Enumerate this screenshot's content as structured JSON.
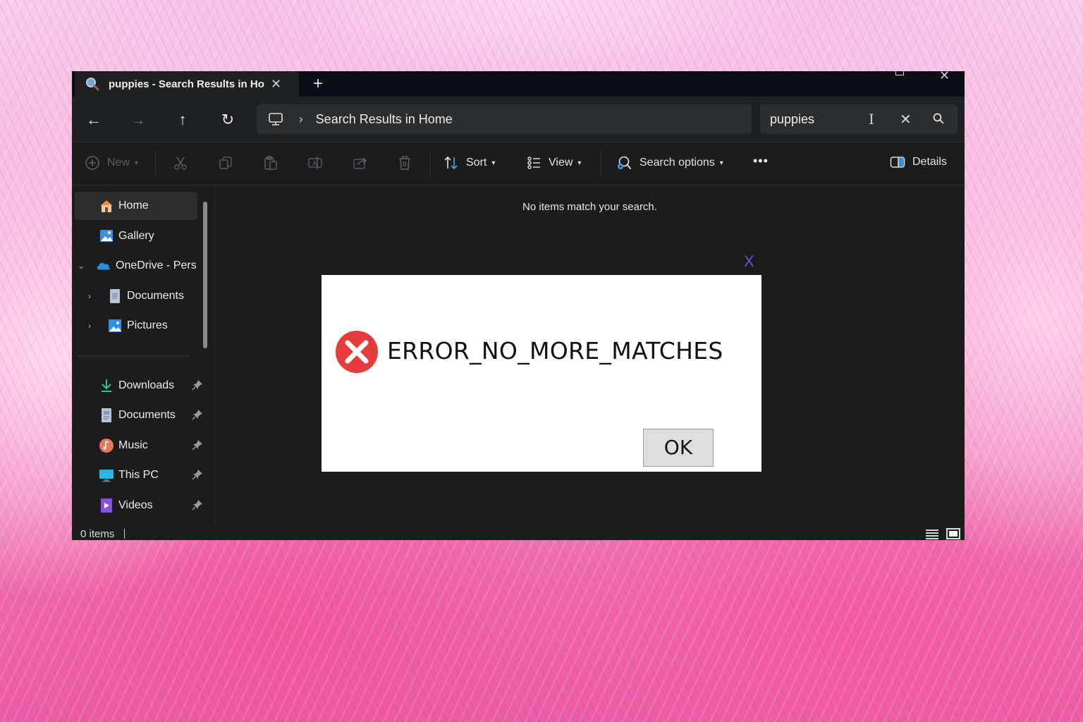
{
  "window": {
    "tab_title": "puppies - Search Results in Ho",
    "tab_icon": "search-icon",
    "new_tab_label": "+",
    "controls": {
      "minimize": "minimize-icon",
      "maximize": "maximize-icon",
      "close": "✕"
    }
  },
  "nav": {
    "back": "←",
    "forward": "→",
    "up": "↑",
    "refresh": "↻",
    "breadcrumb_separator": "›",
    "location": "Search Results in Home"
  },
  "search": {
    "value": "puppies",
    "placeholder": "",
    "clear": "✕"
  },
  "commandbar": {
    "new_label": "New",
    "sort_label": "Sort",
    "view_label": "View",
    "search_options_label": "Search options",
    "more_label": "•••",
    "details_label": "Details",
    "disabled_actions": [
      "cut",
      "copy",
      "paste",
      "rename",
      "share",
      "delete"
    ]
  },
  "sidebar": {
    "items": [
      {
        "label": "Home",
        "icon": "home-icon",
        "selected": true
      },
      {
        "label": "Gallery",
        "icon": "gallery-icon"
      },
      {
        "label": "OneDrive - Perso",
        "icon": "onedrive-icon",
        "expanded": true
      },
      {
        "label": "Documents",
        "icon": "documents-icon",
        "child": true
      },
      {
        "label": "Pictures",
        "icon": "pictures-icon",
        "child": true
      }
    ],
    "quick_access": [
      {
        "label": "Downloads",
        "icon": "downloads-icon",
        "pinned": true
      },
      {
        "label": "Documents",
        "icon": "documents-icon",
        "pinned": true
      },
      {
        "label": "Music",
        "icon": "music-icon",
        "pinned": true
      },
      {
        "label": "This PC",
        "icon": "this-pc-icon",
        "pinned": true
      },
      {
        "label": "Videos",
        "icon": "videos-icon",
        "pinned": true
      }
    ]
  },
  "content": {
    "empty_message": "No items match your search."
  },
  "statusbar": {
    "item_count": "0 items"
  },
  "dialog": {
    "close_label": "X",
    "message": "ERROR_NO_MORE_MATCHES",
    "ok_label": "OK",
    "icon": "error-icon",
    "icon_color": "#e63b3b",
    "close_color": "#6a52e0"
  }
}
